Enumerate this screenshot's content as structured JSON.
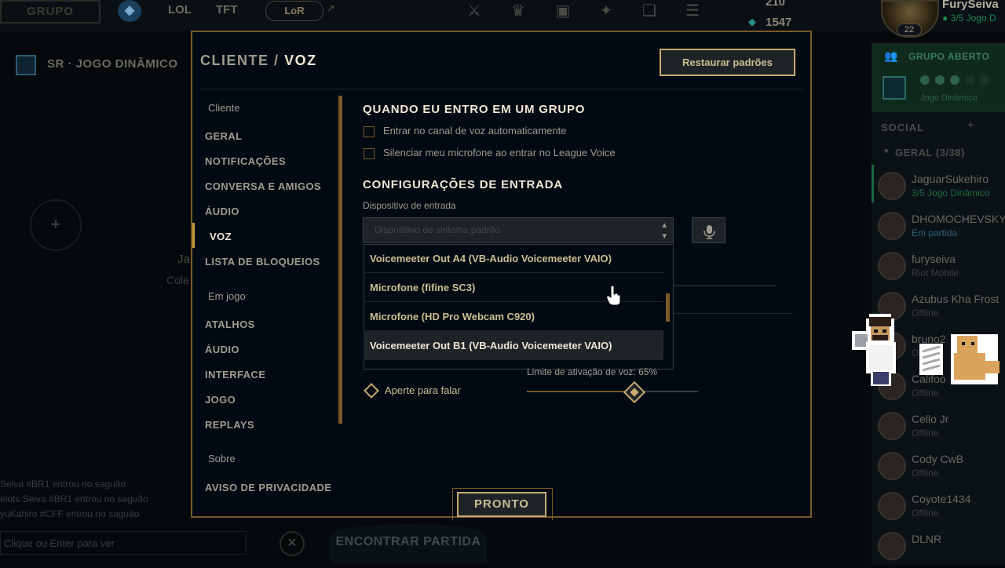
{
  "topbar": {
    "play_label": "GRUPO",
    "nav_lol": "LOL",
    "nav_tft": "TFT",
    "nav_lor": "LoR",
    "rp_amount": "210",
    "be_amount": "1547",
    "summoner_name": "FurySeiva",
    "summoner_status": "3/5 Jogo D",
    "level": "22"
  },
  "background": {
    "lobby_title": "SR · JOGO DINÂMICO",
    "partial_name": "Ja",
    "partial_sub": "Cole",
    "chat_lines": [
      "Seiva #BR1 entrou no saguão",
      "elots Seiva #BR1 entrou no saguão",
      "yuKahiro #CFF entrou no saguão"
    ],
    "chat_placeholder": "Clique ou Enter para ver",
    "find_match": "ENCONTRAR PARTIDA"
  },
  "social": {
    "group_open_title": "GRUPO ABERTO",
    "group_open_sub": "Jogo Dinâmico",
    "social_label": "SOCIAL",
    "general_group": "GERAL (3/38)",
    "friends": [
      {
        "name": "JaguarSukehiro",
        "status": "3/5 Jogo Dinâmico",
        "status_type": "green"
      },
      {
        "name": "DHOMOCHEVSKY",
        "status": "Em partida",
        "status_type": "blue"
      },
      {
        "name": "furyseiva",
        "status": "Riot Mobile",
        "status_type": "grey"
      },
      {
        "name": "Azubus Kha Frost",
        "status": "Offline",
        "status_type": "grey"
      },
      {
        "name": "bruno2",
        "status": "Offline",
        "status_type": "grey"
      },
      {
        "name": "Califoo",
        "status": "Offline",
        "status_type": "grey"
      },
      {
        "name": "Cello Jr",
        "status": "Offline",
        "status_type": "grey"
      },
      {
        "name": "Cody CwB",
        "status": "Offline",
        "status_type": "grey"
      },
      {
        "name": "Coyote1434",
        "status": "Offline",
        "status_type": "grey"
      },
      {
        "name": "DLNR",
        "status": "",
        "status_type": "grey"
      }
    ]
  },
  "modal": {
    "breadcrumb_parent": "CLIENTE",
    "breadcrumb_sep": "/",
    "breadcrumb_current": "VOZ",
    "restore_label": "Restaurar padrões",
    "done_label": "PRONTO",
    "sidebar": {
      "section_client": "Cliente",
      "client_items": [
        "GERAL",
        "NOTIFICAÇÕES",
        "CONVERSA E AMIGOS",
        "ÁUDIO",
        "VOZ",
        "LISTA DE BLOQUEIOS"
      ],
      "active_item": "VOZ",
      "section_ingame": "Em jogo",
      "ingame_items": [
        "ATALHOS",
        "ÁUDIO",
        "INTERFACE",
        "JOGO",
        "REPLAYS"
      ],
      "section_about": "Sobre",
      "about_items": [
        "AVISO DE PRIVACIDADE"
      ]
    },
    "content": {
      "group_header": "QUANDO EU ENTRO EM UM GRUPO",
      "auto_join_label": "Entrar no canal de voz automaticamente",
      "auto_join_checked": false,
      "mute_label": "Silenciar meu microfone ao entrar no League Voice",
      "mute_checked": false,
      "input_header": "CONFIGURAÇÕES DE ENTRADA",
      "input_device_label": "Dispositivo de entrada",
      "input_device_value": "Dispositivo de sistema padrão",
      "dropdown_options": [
        "Voicemeeter Out A4 (VB-Audio Voicemeeter VAIO)",
        "Microfone (fifine SC3)",
        "Microfone (HD Pro Webcam C920)",
        "Voicemeeter Out B1 (VB-Audio Voicemeeter VAIO)"
      ],
      "hovered_option_index": 3,
      "push_to_talk_label": "Aperte para falar",
      "vad_label": "Limite de ativação de voz: 65%",
      "vad_value": 65
    }
  },
  "colors": {
    "gold": "#c8aa6e",
    "gold_dark": "#785a28",
    "text_light": "#f0e6d2",
    "text_muted": "#a09b8c",
    "panel_bg": "#010a13"
  }
}
